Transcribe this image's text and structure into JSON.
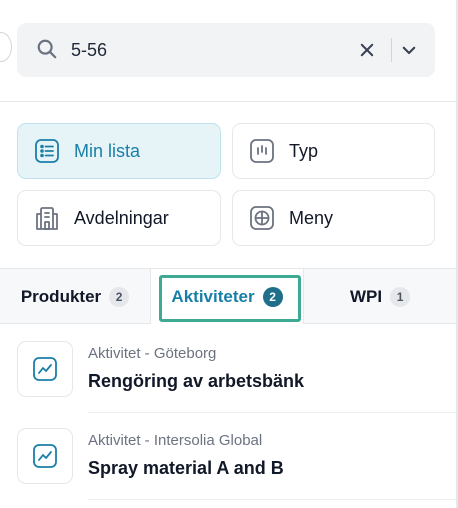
{
  "search": {
    "value": "5-56",
    "icon": "search-icon",
    "clear_icon": "close-icon",
    "dropdown_icon": "chevron-down-icon"
  },
  "filters": [
    {
      "label": "Min lista",
      "icon": "list-icon",
      "active": true
    },
    {
      "label": "Typ",
      "icon": "type-icon",
      "active": false
    },
    {
      "label": "Avdelningar",
      "icon": "building-icon",
      "active": false
    },
    {
      "label": "Meny",
      "icon": "grid-plus-icon",
      "active": false
    }
  ],
  "tabs": [
    {
      "label": "Produkter",
      "count": "2",
      "active": false
    },
    {
      "label": "Aktiviteter",
      "count": "2",
      "active": true
    },
    {
      "label": "WPI",
      "count": "1",
      "active": false
    }
  ],
  "results": [
    {
      "meta": "Aktivitet - Göteborg",
      "title": "Rengöring av arbetsbänk",
      "icon": "activity-chart-icon"
    },
    {
      "meta": "Aktivitet - Intersolia Global",
      "title": "Spray material A and B",
      "icon": "activity-chart-icon"
    }
  ],
  "colors": {
    "accent": "#1a7fa8",
    "active_bg": "#e6f4f8",
    "focus_ring": "#3eaa93",
    "badge_active": "#1f6f8b"
  }
}
